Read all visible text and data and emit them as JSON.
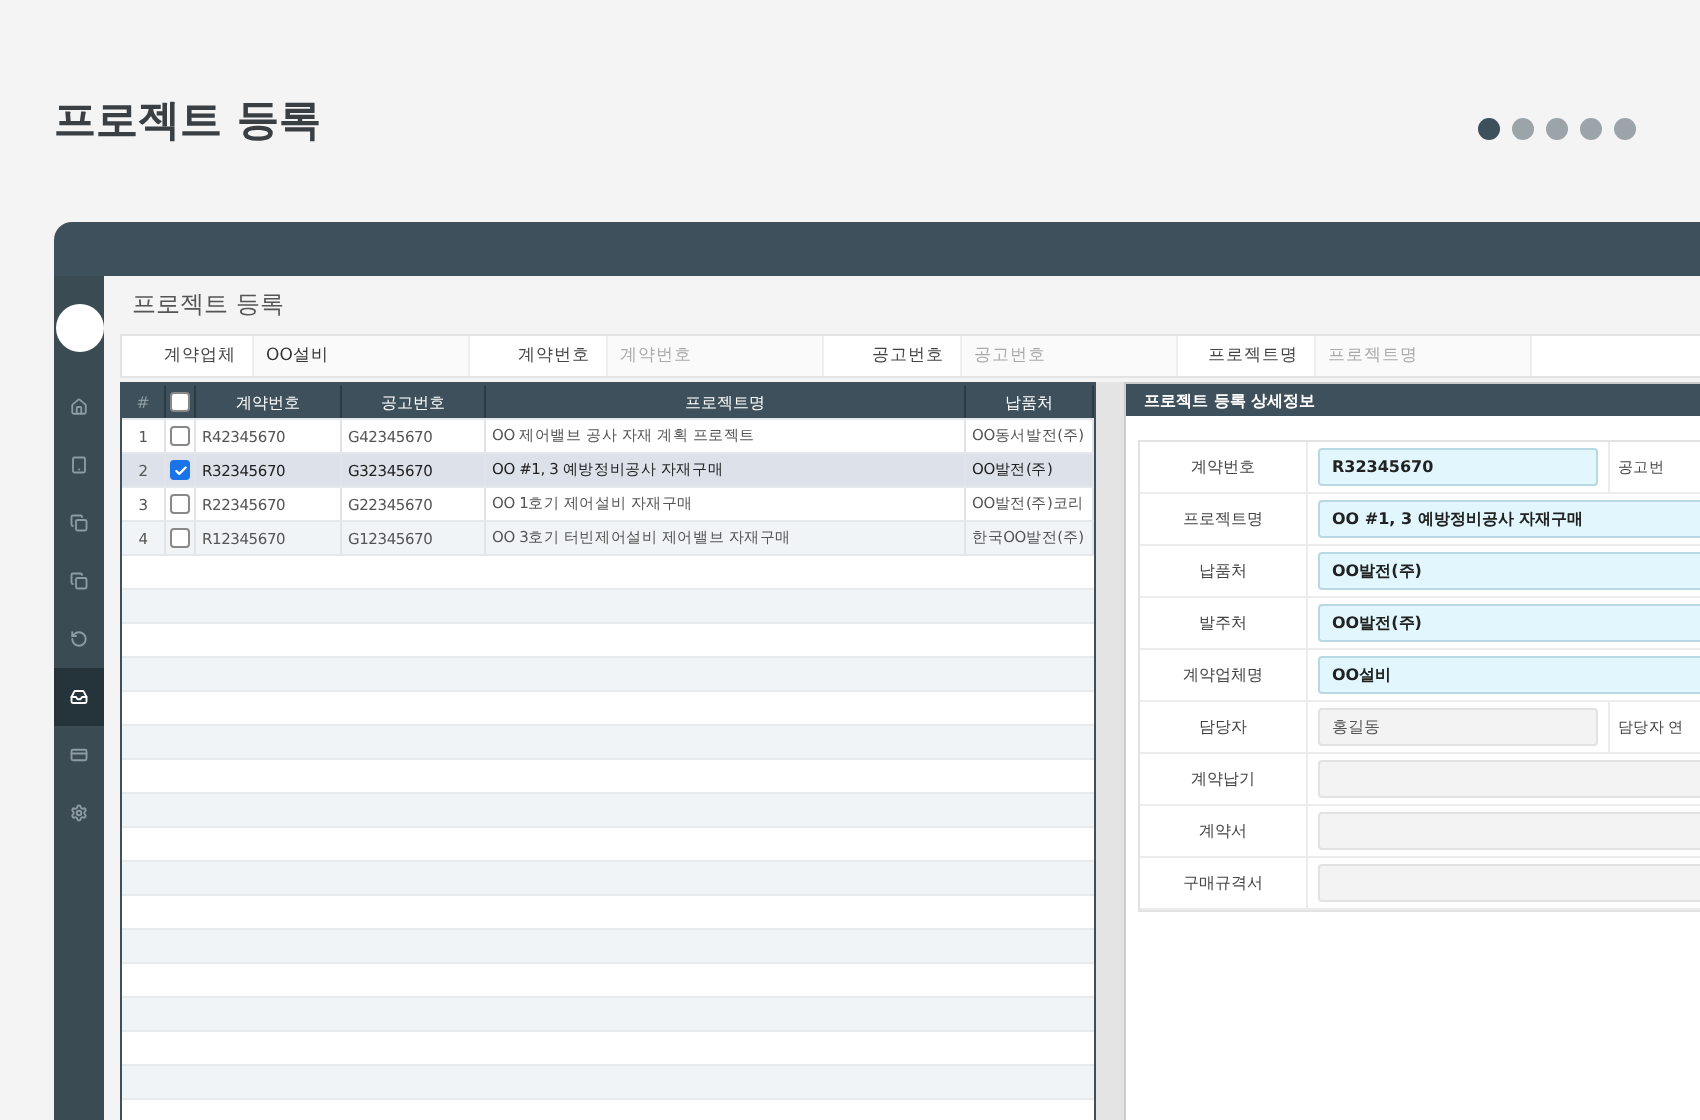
{
  "page_title": "프로젝트 등록",
  "pager_dots": [
    {
      "selected": true
    },
    {
      "selected": false
    },
    {
      "selected": false
    },
    {
      "selected": false
    },
    {
      "selected": false
    }
  ],
  "sidebar": {
    "items": [
      {
        "selected": false
      },
      {
        "selected": false
      },
      {
        "selected": false
      },
      {
        "selected": false
      },
      {
        "selected": false
      },
      {
        "selected": true
      },
      {
        "selected": false
      },
      {
        "selected": false
      }
    ]
  },
  "screen_title": "프로젝트 등록",
  "filters": [
    {
      "label": "계약업체",
      "value": "OO설비"
    },
    {
      "label": "계약번호",
      "placeholder": "계약번호"
    },
    {
      "label": "공고번호",
      "placeholder": "공고번호"
    },
    {
      "label": "프로젝트명",
      "placeholder": "프로젝트명"
    }
  ],
  "table": {
    "columns": [
      "#",
      "",
      "계약번호",
      "공고번호",
      "프로젝트명",
      "납품처"
    ],
    "header_checked": false,
    "rows": [
      {
        "checked": false,
        "selected": false,
        "cells": [
          "1",
          "",
          "R42345670",
          "G42345670",
          "OO 제어밸브 공사 자재 계획 프로젝트",
          "OO동서발전(주)"
        ]
      },
      {
        "checked": true,
        "selected": true,
        "cells": [
          "2",
          "",
          "R32345670",
          "G32345670",
          "OO #1, 3 예방정비공사 자재구매",
          "OO발전(주)"
        ]
      },
      {
        "checked": false,
        "selected": false,
        "cells": [
          "3",
          "",
          "R22345670",
          "G22345670",
          "OO 1호기 제어설비 자재구매",
          "OO발전(주)코리"
        ]
      },
      {
        "checked": false,
        "selected": false,
        "cells": [
          "4",
          "",
          "R12345670",
          "G12345670",
          "OO 3호기 터빈제어설비 제어밸브 자재구매",
          "한국OO발전(주)"
        ]
      }
    ]
  },
  "detail": {
    "title": "프로젝트 등록 상세정보",
    "rows": [
      {
        "kind": "pair",
        "label": "계약번호",
        "value": "R32345670",
        "highlighted": true,
        "label_2": "공고번"
      },
      {
        "kind": "wide",
        "label": "프로젝트명",
        "value": "OO #1, 3 예방정비공사 자재구매",
        "highlighted": true
      },
      {
        "kind": "wide",
        "label": "납품처",
        "value": "OO발전(주)",
        "highlighted": true
      },
      {
        "kind": "wide",
        "label": "발주처",
        "value": "OO발전(주)",
        "highlighted": true
      },
      {
        "kind": "wide",
        "label": "계약업체명",
        "value": "OO설비",
        "highlighted": true
      },
      {
        "kind": "pair",
        "label": "담당자",
        "value": "홍길동",
        "highlighted": false,
        "label_2": "담당자 연"
      },
      {
        "kind": "wide",
        "label": "계약납기",
        "highlighted": false
      },
      {
        "kind": "wide",
        "label": "계약서",
        "highlighted": false
      },
      {
        "kind": "wide",
        "label": "구매규격서",
        "highlighted": false
      }
    ]
  }
}
